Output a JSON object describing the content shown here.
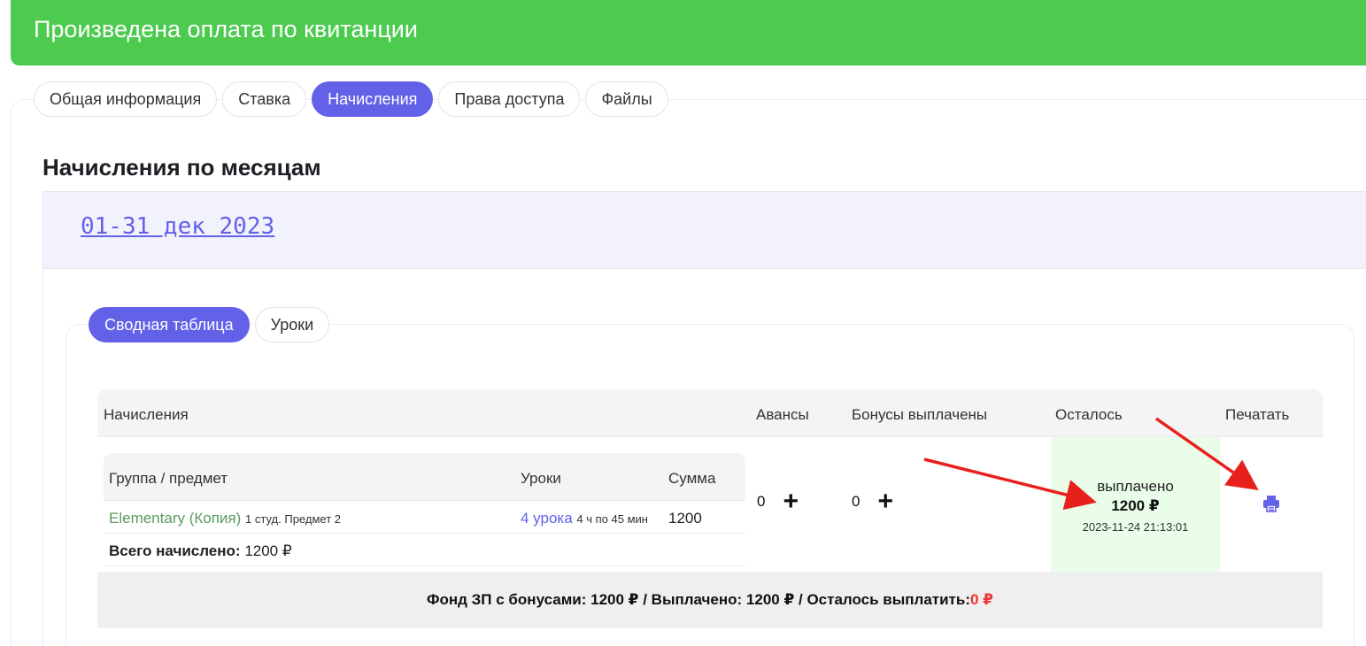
{
  "banner": {
    "message": "Произведена оплата по квитанции"
  },
  "tabs": [
    {
      "label": "Общая информация"
    },
    {
      "label": "Ставка"
    },
    {
      "label": "Начисления",
      "active": true
    },
    {
      "label": "Права доступа"
    },
    {
      "label": "Файлы"
    }
  ],
  "section": {
    "title": "Начисления по месяцам"
  },
  "month": {
    "label": "01-31 дек 2023"
  },
  "subtabs": [
    {
      "label": "Сводная таблица",
      "active": true
    },
    {
      "label": "Уроки"
    }
  ],
  "table": {
    "headers": {
      "accruals": "Начисления",
      "advances": "Авансы",
      "bonuses": "Бонусы выплачены",
      "remaining": "Осталось",
      "print": "Печатать"
    },
    "sub_headers": {
      "group": "Группа / предмет",
      "lessons": "Уроки",
      "sum": "Сумма"
    },
    "row": {
      "group_name": "Elementary (Копия)",
      "group_meta": "1 студ. Предмет 2",
      "lessons_count": "4 урока",
      "lessons_meta": "4 ч по 45 мин",
      "sum": "1200"
    },
    "total": {
      "label": "Всего начислено:",
      "value": "1200 ₽"
    },
    "advances_value": "0",
    "bonuses_value": "0",
    "remaining": {
      "status": "выплачено",
      "amount": "1200 ₽",
      "date": "2023-11-24 21:13:01"
    }
  },
  "fund": {
    "text": "Фонд ЗП с бонусами: 1200 ₽ / Выплачено: 1200 ₽ / Осталось выплатить: ",
    "remaining_value": "0 ₽"
  },
  "colors": {
    "banner": "#4ccb4f",
    "accent": "#6361e8",
    "paid_cell": "#e9fde9",
    "annotation_arrow": "#e8201c",
    "remaining_value": "#ee3333"
  },
  "icons": {
    "print": "printer-icon",
    "add": "plus-icon"
  }
}
